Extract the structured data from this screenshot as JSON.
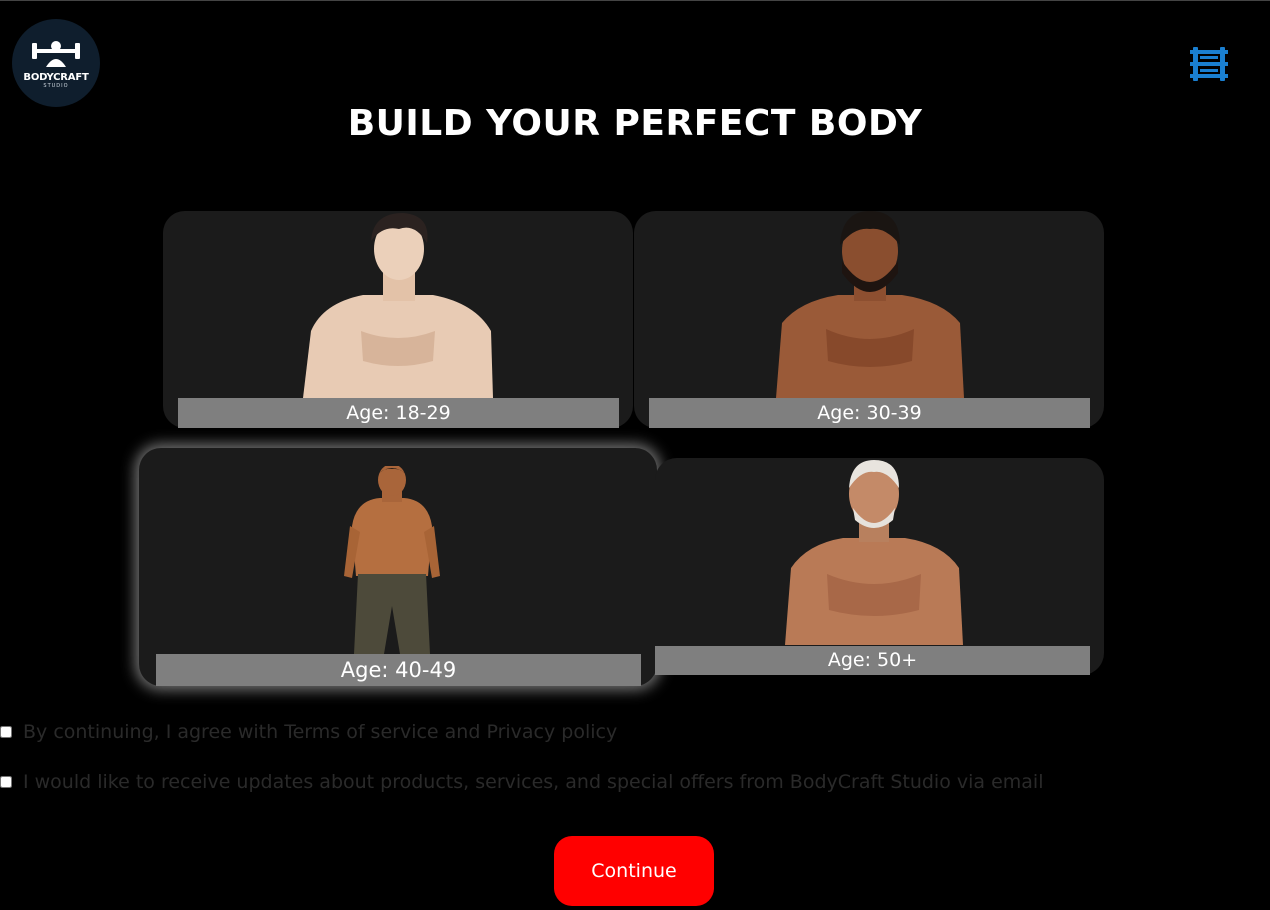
{
  "brand": {
    "name": "BODYCRAFT",
    "subtitle": "STUDIO"
  },
  "header": {
    "menu_icon": "dumbbell-menu-icon"
  },
  "page": {
    "title": "BUILD YOUR PERFECT BODY"
  },
  "age_options": [
    {
      "label": "Age: 18-29"
    },
    {
      "label": "Age: 30-39"
    },
    {
      "label": "Age: 40-49",
      "selected": true
    },
    {
      "label": "Age: 50+"
    }
  ],
  "consent": {
    "terms_label": "By continuing, I agree with Terms of service and Privacy policy",
    "terms_checked": false,
    "updates_label": "I would like to receive updates about products, services, and special offers from BodyCraft Studio via email",
    "updates_checked": false
  },
  "actions": {
    "continue_label": "Continue"
  },
  "colors": {
    "background": "#000000",
    "card": "#1b1b1b",
    "label_bar": "#7f7f7f",
    "accent": "#ff0000",
    "menu_icon": "#1a7fd0"
  }
}
